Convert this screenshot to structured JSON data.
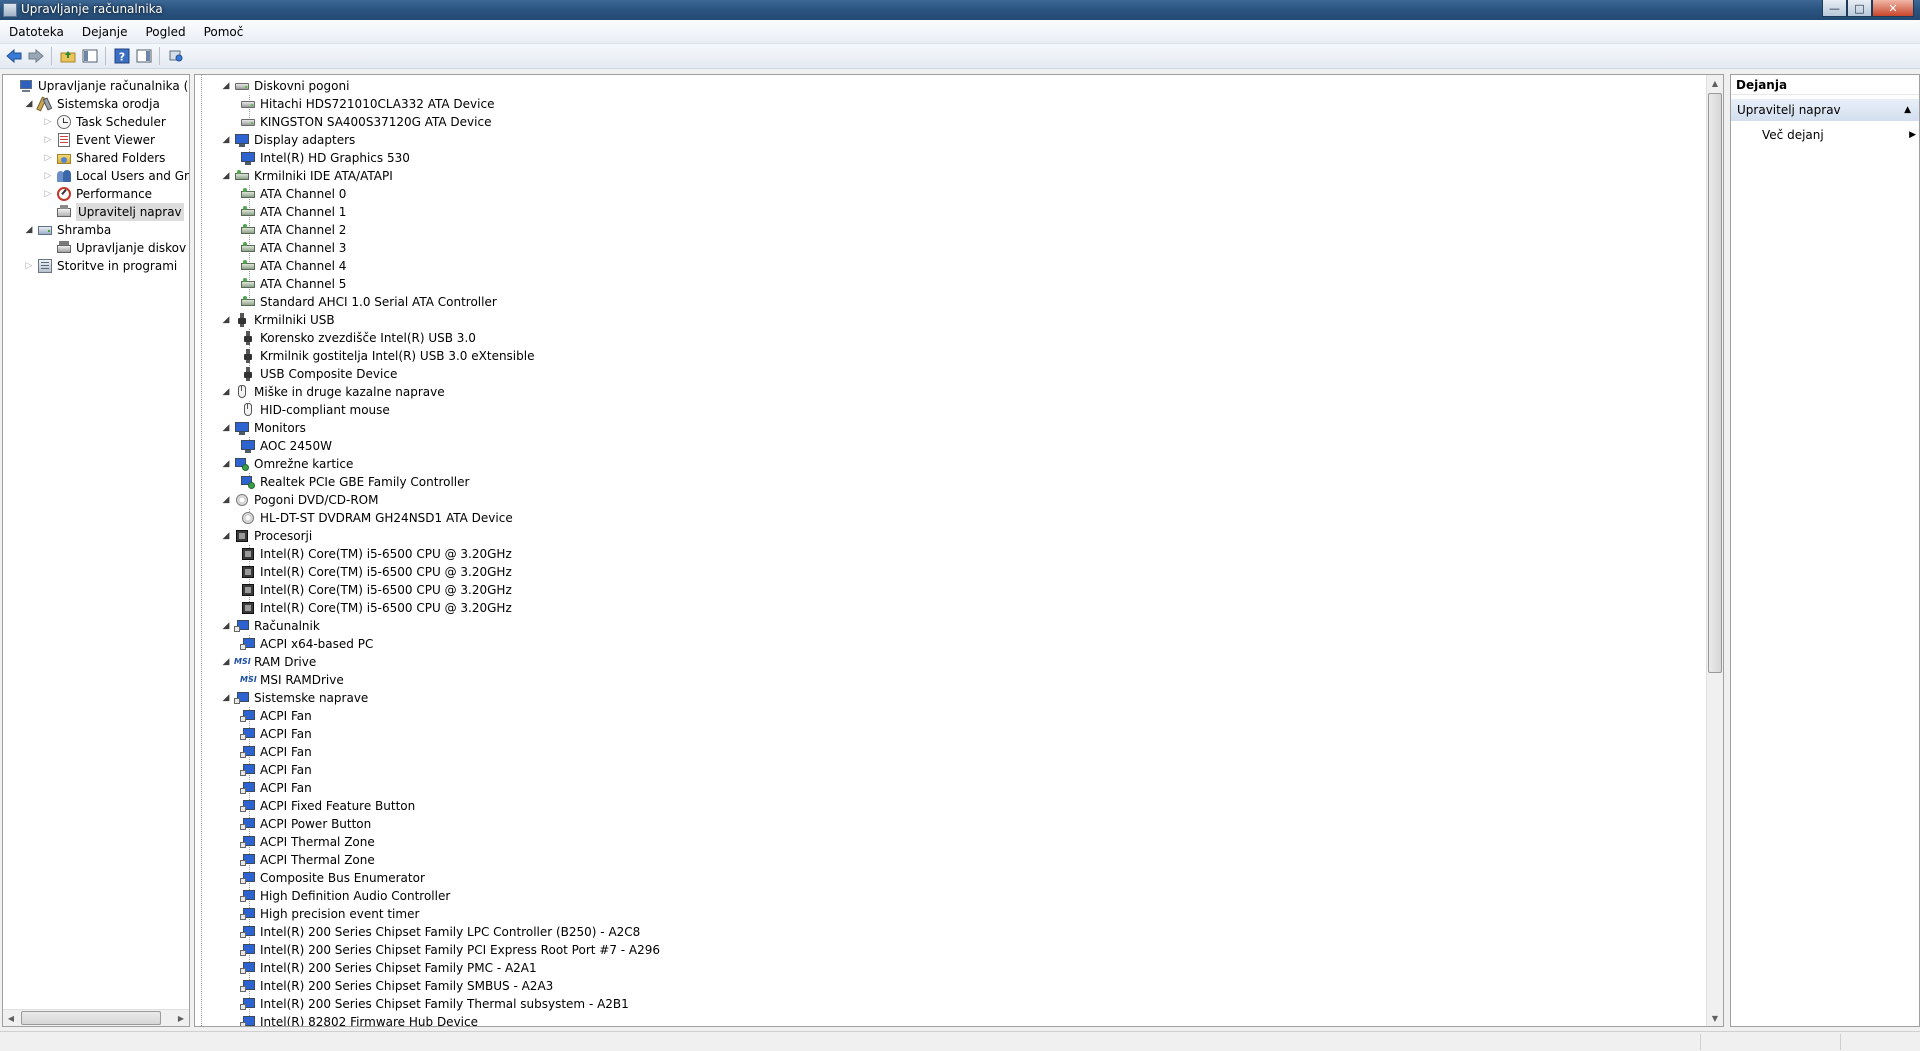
{
  "window": {
    "title": "Upravljanje računalnika",
    "buttons": {
      "minimize": "—",
      "maximize": "□",
      "close": "✕"
    }
  },
  "menu": [
    "Datoteka",
    "Dejanje",
    "Pogled",
    "Pomoč"
  ],
  "toolbar": {
    "icons": [
      "back-arrow-icon",
      "forward-arrow-icon",
      "up-folder-icon",
      "show-hide-tree-icon",
      "help-icon",
      "show-hide-action-pane-icon",
      "properties-icon"
    ]
  },
  "left_tree": [
    {
      "label": "Upravljanje računalnika (lokaln",
      "icon": "computer",
      "depth": 0,
      "expander": "none"
    },
    {
      "label": "Sistemska orodja",
      "icon": "tools",
      "depth": 1,
      "expander": "open"
    },
    {
      "label": "Task Scheduler",
      "icon": "clock",
      "depth": 2,
      "expander": "closed"
    },
    {
      "label": "Event Viewer",
      "icon": "event",
      "depth": 2,
      "expander": "closed"
    },
    {
      "label": "Shared Folders",
      "icon": "folder",
      "depth": 2,
      "expander": "closed"
    },
    {
      "label": "Local Users and Groups",
      "icon": "users",
      "depth": 2,
      "expander": "closed"
    },
    {
      "label": "Performance",
      "icon": "perf",
      "depth": 2,
      "expander": "closed"
    },
    {
      "label": "Upravitelj naprav",
      "icon": "devmgr",
      "depth": 2,
      "expander": "none",
      "selected": true
    },
    {
      "label": "Shramba",
      "icon": "storage",
      "depth": 1,
      "expander": "open"
    },
    {
      "label": "Upravljanje diskov",
      "icon": "diskmgmt",
      "depth": 2,
      "expander": "none"
    },
    {
      "label": "Storitve in programi",
      "icon": "services",
      "depth": 1,
      "expander": "closed"
    }
  ],
  "device_tree": [
    {
      "label": "Diskovni pogoni",
      "icon": "disk",
      "category": true
    },
    {
      "label": "Hitachi HDS721010CLA332 ATA Device",
      "icon": "disk"
    },
    {
      "label": "KINGSTON SA400S37120G ATA Device",
      "icon": "disk"
    },
    {
      "label": "Display adapters",
      "icon": "display",
      "category": true
    },
    {
      "label": "Intel(R) HD Graphics 530",
      "icon": "display"
    },
    {
      "label": "Krmilniki IDE ATA/ATAPI",
      "icon": "ide",
      "category": true
    },
    {
      "label": "ATA Channel 0",
      "icon": "ide"
    },
    {
      "label": "ATA Channel 1",
      "icon": "ide"
    },
    {
      "label": "ATA Channel 2",
      "icon": "ide"
    },
    {
      "label": "ATA Channel 3",
      "icon": "ide"
    },
    {
      "label": "ATA Channel 4",
      "icon": "ide"
    },
    {
      "label": "ATA Channel 5",
      "icon": "ide"
    },
    {
      "label": "Standard AHCI 1.0 Serial ATA Controller",
      "icon": "ide"
    },
    {
      "label": "Krmilniki USB",
      "icon": "usb",
      "category": true
    },
    {
      "label": "Korensko zvezdišče Intel(R) USB 3.0",
      "icon": "usb"
    },
    {
      "label": "Krmilnik gostitelja Intel(R) USB 3.0 eXtensible",
      "icon": "usb"
    },
    {
      "label": "USB Composite Device",
      "icon": "usb"
    },
    {
      "label": "Miške in druge kazalne naprave",
      "icon": "mouse",
      "category": true
    },
    {
      "label": "HID-compliant mouse",
      "icon": "mouse"
    },
    {
      "label": "Monitors",
      "icon": "display",
      "category": true
    },
    {
      "label": "AOC 2450W",
      "icon": "display"
    },
    {
      "label": "Omrežne kartice",
      "icon": "net",
      "category": true
    },
    {
      "label": "Realtek PCIe GBE Family Controller",
      "icon": "net"
    },
    {
      "label": "Pogoni DVD/CD-ROM",
      "icon": "dvd",
      "category": true
    },
    {
      "label": "HL-DT-ST DVDRAM GH24NSD1 ATA Device",
      "icon": "dvd"
    },
    {
      "label": "Procesorji",
      "icon": "cpu",
      "category": true
    },
    {
      "label": "Intel(R) Core(TM) i5-6500 CPU @ 3.20GHz",
      "icon": "cpu"
    },
    {
      "label": "Intel(R) Core(TM) i5-6500 CPU @ 3.20GHz",
      "icon": "cpu"
    },
    {
      "label": "Intel(R) Core(TM) i5-6500 CPU @ 3.20GHz",
      "icon": "cpu"
    },
    {
      "label": "Intel(R) Core(TM) i5-6500 CPU @ 3.20GHz",
      "icon": "cpu"
    },
    {
      "label": "Računalnik",
      "icon": "sysdev",
      "category": true
    },
    {
      "label": "ACPI x64-based PC",
      "icon": "sysdev"
    },
    {
      "label": "RAM Drive",
      "icon": "ram",
      "category": true
    },
    {
      "label": "MSI RAMDrive",
      "icon": "ram"
    },
    {
      "label": "Sistemske naprave",
      "icon": "sysdev",
      "category": true
    },
    {
      "label": "ACPI Fan",
      "icon": "sysdev"
    },
    {
      "label": "ACPI Fan",
      "icon": "sysdev"
    },
    {
      "label": "ACPI Fan",
      "icon": "sysdev"
    },
    {
      "label": "ACPI Fan",
      "icon": "sysdev"
    },
    {
      "label": "ACPI Fan",
      "icon": "sysdev"
    },
    {
      "label": "ACPI Fixed Feature Button",
      "icon": "sysdev"
    },
    {
      "label": "ACPI Power Button",
      "icon": "sysdev"
    },
    {
      "label": "ACPI Thermal Zone",
      "icon": "sysdev"
    },
    {
      "label": "ACPI Thermal Zone",
      "icon": "sysdev"
    },
    {
      "label": "Composite Bus Enumerator",
      "icon": "sysdev"
    },
    {
      "label": "High Definition Audio Controller",
      "icon": "sysdev"
    },
    {
      "label": "High precision event timer",
      "icon": "sysdev"
    },
    {
      "label": "Intel(R) 200 Series Chipset Family LPC Controller (B250) - A2C8",
      "icon": "sysdev"
    },
    {
      "label": "Intel(R) 200 Series Chipset Family PCI Express Root Port #7 - A296",
      "icon": "sysdev"
    },
    {
      "label": "Intel(R) 200 Series Chipset Family PMC - A2A1",
      "icon": "sysdev"
    },
    {
      "label": "Intel(R) 200 Series Chipset Family SMBUS - A2A3",
      "icon": "sysdev"
    },
    {
      "label": "Intel(R) 200 Series Chipset Family Thermal subsystem - A2B1",
      "icon": "sysdev"
    },
    {
      "label": "Intel(R) 82802 Firmware Hub Device",
      "icon": "sysdev"
    }
  ],
  "actions": {
    "header": "Dejanja",
    "section": "Upravitelj naprav",
    "items": [
      "Več dejanj"
    ]
  },
  "colors": {
    "titlebar": "#2a5480",
    "selection": "#dcdcdc",
    "action_section": "#d3dfef"
  }
}
